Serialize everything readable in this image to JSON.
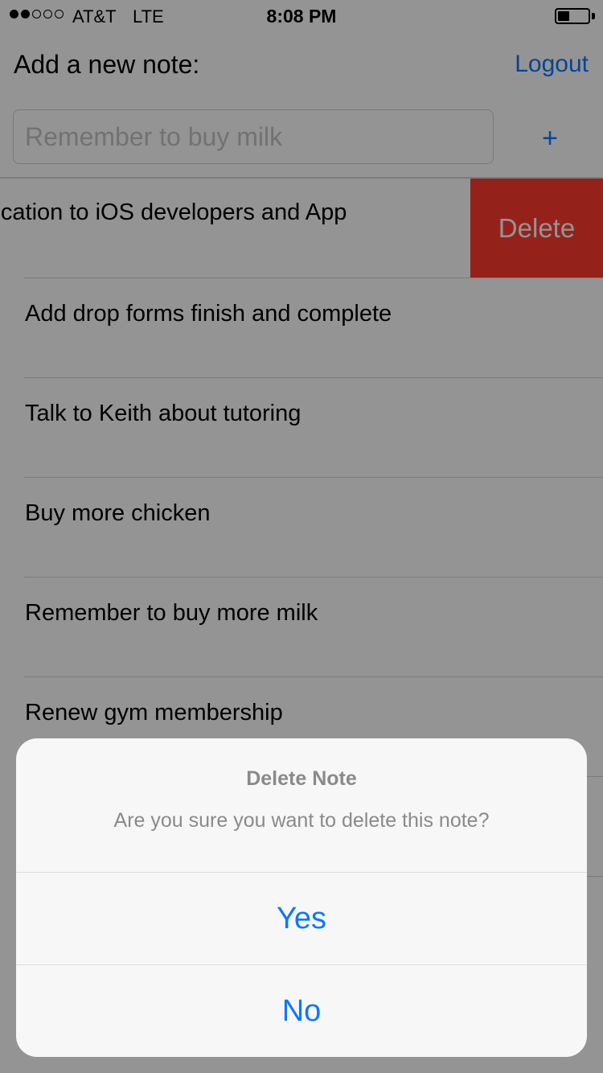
{
  "status_bar": {
    "carrier": "AT&T",
    "network": "LTE",
    "time": "8:08 PM",
    "signal_bars_filled": 2,
    "signal_bars_total": 5,
    "battery_level": 0.4
  },
  "header": {
    "label": "Add a new note:",
    "logout_label": "Logout"
  },
  "input": {
    "placeholder": "Remember to buy milk",
    "add_label": "+"
  },
  "notes": {
    "swiped": {
      "text": "lication to iOS developers and App",
      "delete_label": "Delete"
    },
    "items": [
      "Add drop forms finish and complete",
      "Talk to Keith about tutoring",
      "Buy more chicken",
      "Remember to buy more milk",
      "Renew gym membership"
    ]
  },
  "alert": {
    "title": "Delete Note",
    "message": "Are you sure you want to delete this note?",
    "yes_label": "Yes",
    "no_label": "No"
  },
  "colors": {
    "accent": "#0a78ff",
    "destructive": "#ff3b30"
  }
}
